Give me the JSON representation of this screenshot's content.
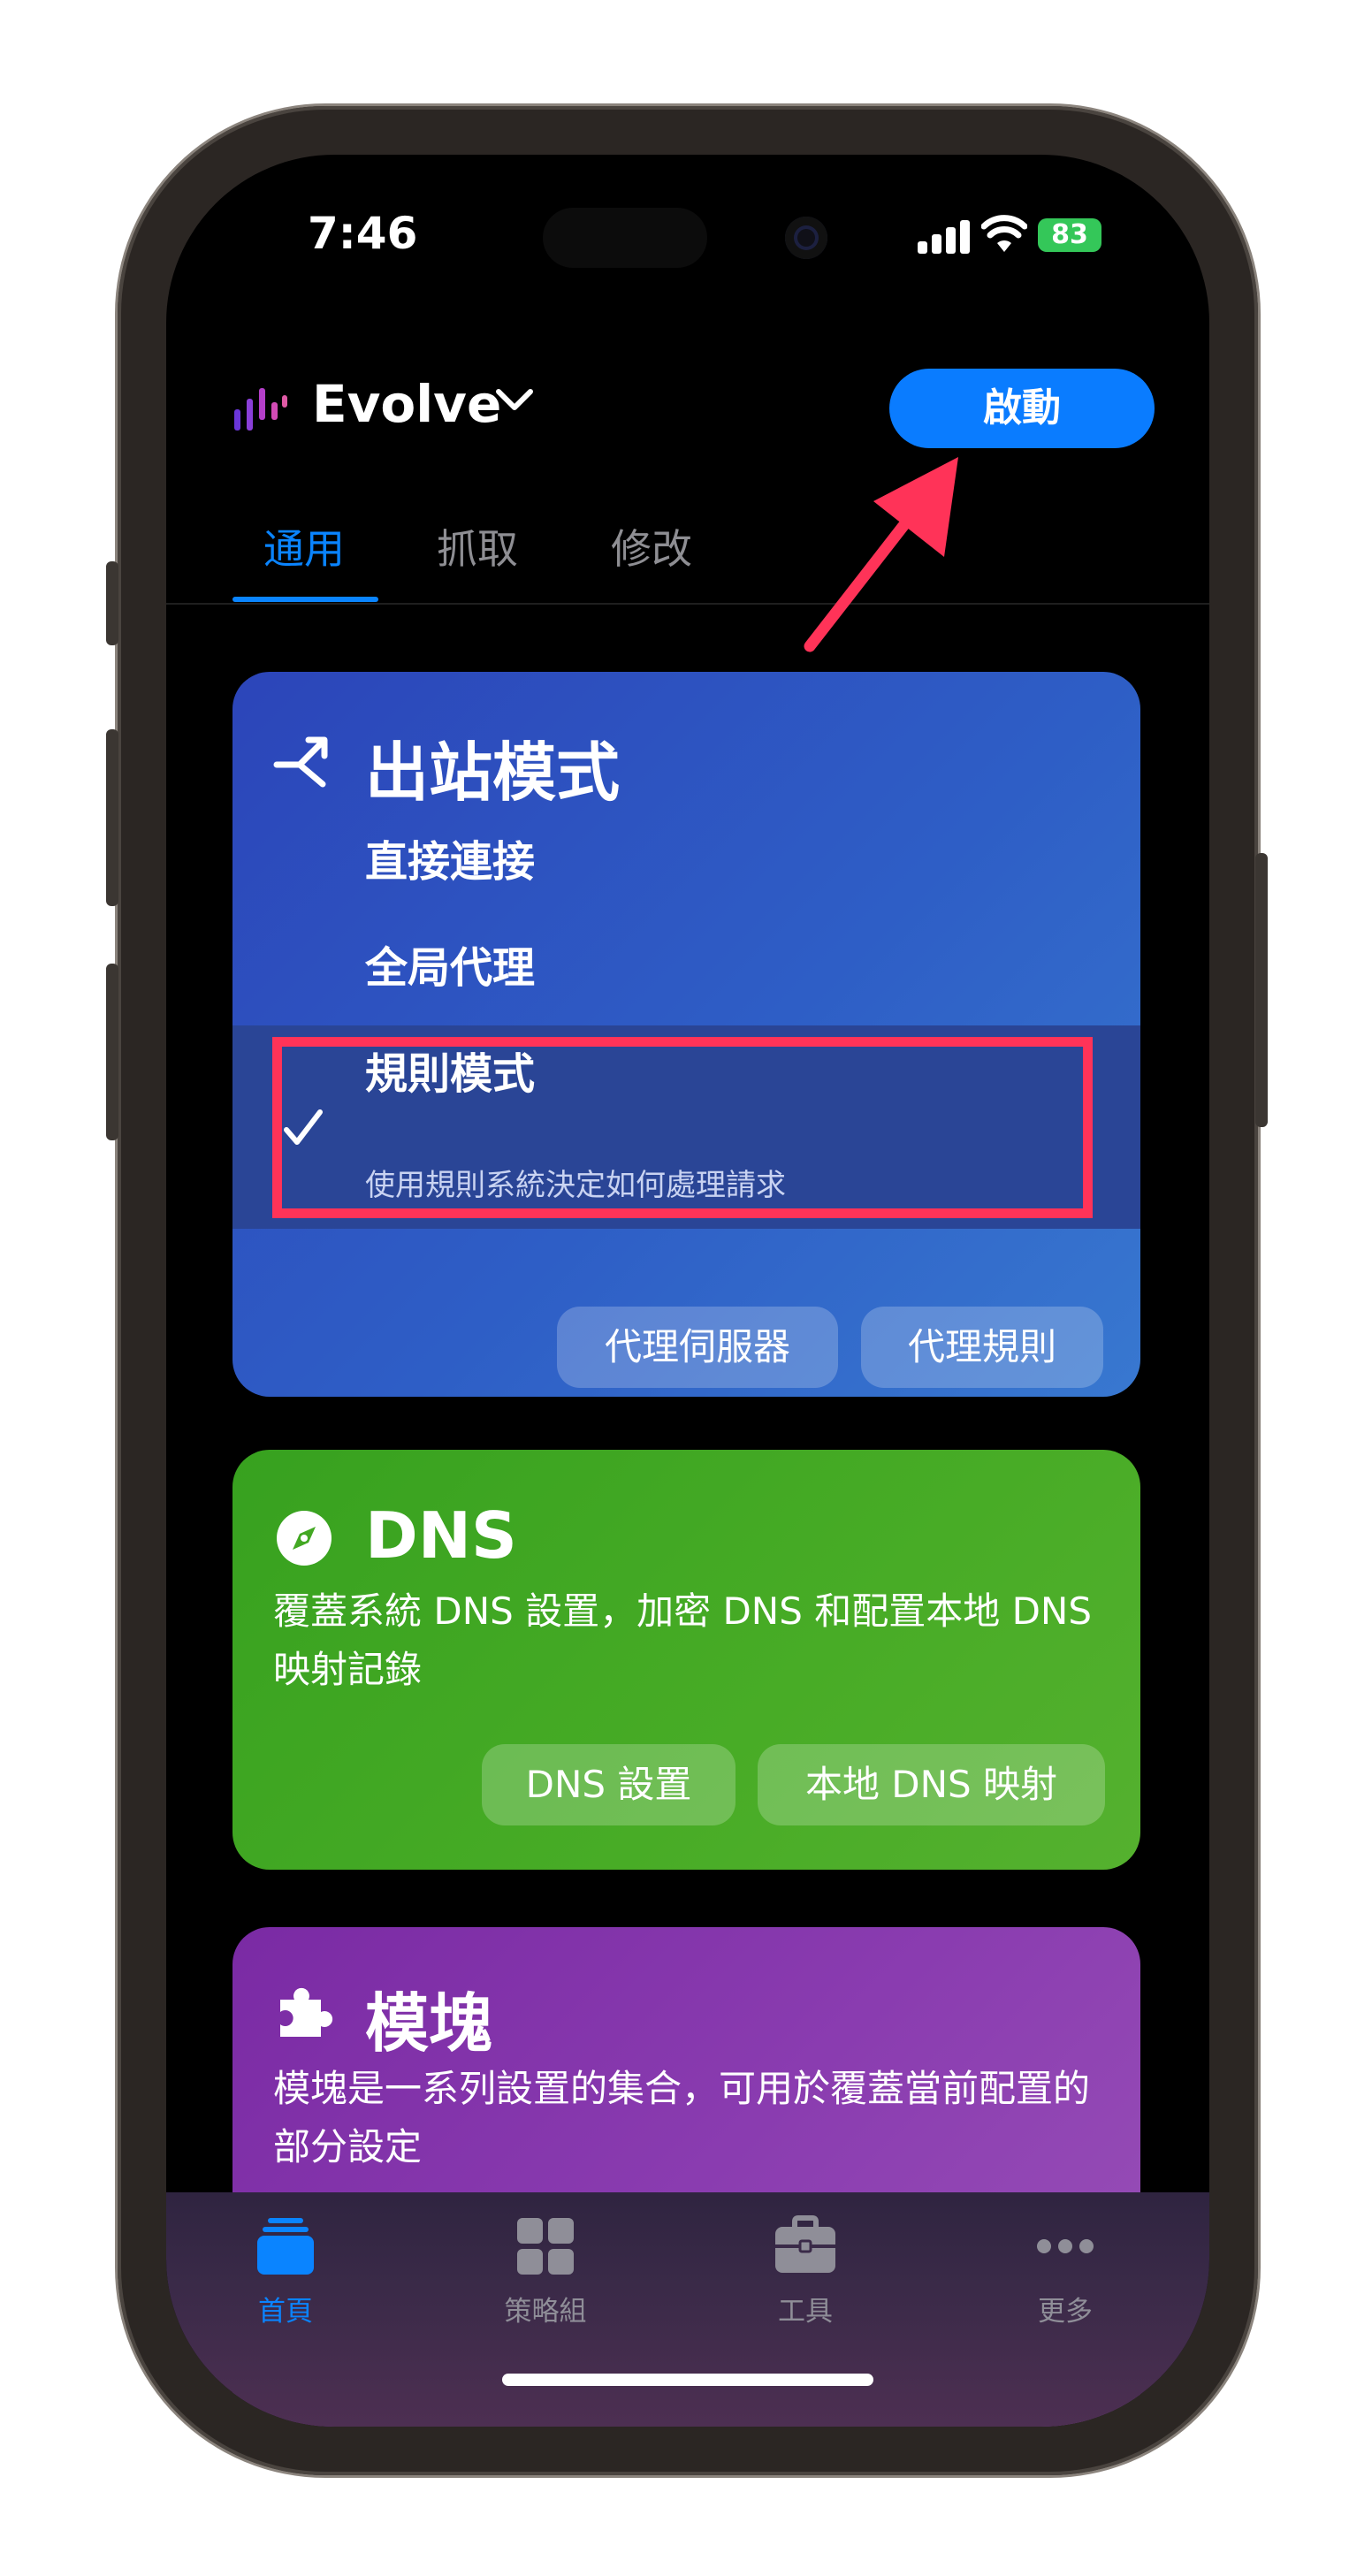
{
  "status_bar": {
    "time": "7:46",
    "battery": "83"
  },
  "header": {
    "app_name": "Evolve",
    "start_button": "啟動"
  },
  "tabs": [
    {
      "label": "通用"
    },
    {
      "label": "抓取"
    },
    {
      "label": "修改"
    }
  ],
  "outbound_card": {
    "title": "出站模式",
    "options": [
      {
        "label": "直接連接"
      },
      {
        "label": "全局代理"
      },
      {
        "label": "規則模式",
        "description": "使用規則系統決定如何處理請求"
      }
    ],
    "buttons": {
      "proxy_servers": "代理伺服器",
      "proxy_rules": "代理規則"
    }
  },
  "dns_card": {
    "title": "DNS",
    "description": "覆蓋系統 DNS 設置，加密 DNS 和配置本地 DNS 映射記錄",
    "buttons": {
      "dns_settings": "DNS 設置",
      "local_dns_mapping": "本地 DNS 映射"
    }
  },
  "module_card": {
    "title": "模塊",
    "description": "模塊是一系列設置的集合，可用於覆蓋當前配置的部分設定"
  },
  "tab_bar": [
    {
      "label": "首頁",
      "icon": "home-stack-icon"
    },
    {
      "label": "策略組",
      "icon": "grid-icon"
    },
    {
      "label": "工具",
      "icon": "toolbox-icon"
    },
    {
      "label": "更多",
      "icon": "more-dots-icon"
    }
  ],
  "colors": {
    "accent": "#0a84ff",
    "annotation": "#ff3358"
  }
}
